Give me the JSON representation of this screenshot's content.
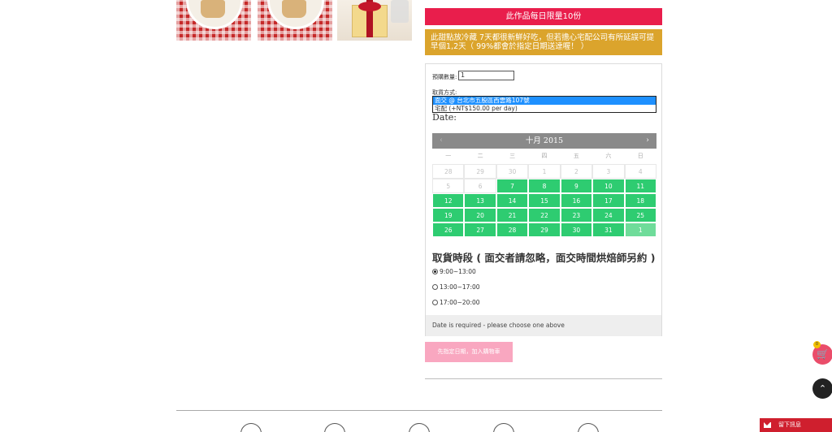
{
  "banners": {
    "daily_limit": "此作品每日限量10份",
    "shipping_note": "此甜點放冷藏 7天都很新鮮好吃，但若擔心宅配公司有所延誤可提早個1,2天（ 99%都會於指定日期送達喔！ ）"
  },
  "form": {
    "quantity_label": "預購數量:",
    "quantity_value": "1",
    "pickup_label": "取貨方式:",
    "pickup_options": [
      "面交 @ 台北市五股區西雲路107號",
      "宅配 (+NT$150.00 per day)"
    ],
    "pickup_selected_index": 0,
    "date_label": "Date:"
  },
  "calendar": {
    "month_label": "十月 2015",
    "prev_icon": "chevron-left-icon",
    "next_icon": "chevron-right-icon",
    "weekdays": [
      "一",
      "二",
      "三",
      "四",
      "五",
      "六",
      "日"
    ],
    "weeks": [
      [
        {
          "d": "28",
          "s": "dis"
        },
        {
          "d": "29",
          "s": "dis"
        },
        {
          "d": "30",
          "s": "dis"
        },
        {
          "d": "1",
          "s": "dis"
        },
        {
          "d": "2",
          "s": "dis"
        },
        {
          "d": "3",
          "s": "dis"
        },
        {
          "d": "4",
          "s": "dis"
        }
      ],
      [
        {
          "d": "5",
          "s": "dis"
        },
        {
          "d": "6",
          "s": "dis"
        },
        {
          "d": "7",
          "s": "av"
        },
        {
          "d": "8",
          "s": "av"
        },
        {
          "d": "9",
          "s": "av"
        },
        {
          "d": "10",
          "s": "av"
        },
        {
          "d": "11",
          "s": "av"
        }
      ],
      [
        {
          "d": "12",
          "s": "av"
        },
        {
          "d": "13",
          "s": "av"
        },
        {
          "d": "14",
          "s": "av"
        },
        {
          "d": "15",
          "s": "av"
        },
        {
          "d": "16",
          "s": "av"
        },
        {
          "d": "17",
          "s": "av"
        },
        {
          "d": "18",
          "s": "av"
        }
      ],
      [
        {
          "d": "19",
          "s": "av"
        },
        {
          "d": "20",
          "s": "av"
        },
        {
          "d": "21",
          "s": "av"
        },
        {
          "d": "22",
          "s": "av"
        },
        {
          "d": "23",
          "s": "av"
        },
        {
          "d": "24",
          "s": "av"
        },
        {
          "d": "25",
          "s": "av"
        }
      ],
      [
        {
          "d": "26",
          "s": "av"
        },
        {
          "d": "27",
          "s": "av"
        },
        {
          "d": "28",
          "s": "av"
        },
        {
          "d": "29",
          "s": "av"
        },
        {
          "d": "30",
          "s": "av"
        },
        {
          "d": "31",
          "s": "av"
        },
        {
          "d": "1",
          "s": "pale"
        }
      ]
    ]
  },
  "timeslot": {
    "title": "取貨時段 ( 面交者請忽略，面交時間烘焙師另約 )",
    "options": [
      "9:00~13:00",
      "13:00~17:00",
      "17:00~20:00"
    ],
    "selected_index": 0
  },
  "validation": {
    "message": "Date is required - please choose one above"
  },
  "actions": {
    "add_to_cart": "先指定日期，加入購物車"
  },
  "floating": {
    "cart_count": "0",
    "cart_icon": "cart-icon",
    "top_icon": "chevron-up-icon",
    "message_label": "留下訊息",
    "message_icon": "envelope-icon"
  },
  "colors": {
    "banner_red": "#e91e4c",
    "banner_gold": "#dba42c",
    "calendar_available": "#2ecc71",
    "cart_button": "#f9a7c0"
  }
}
